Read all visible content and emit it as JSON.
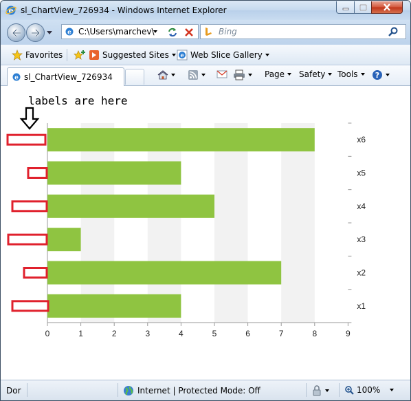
{
  "window": {
    "title": "sl_ChartView_726934 - Windows Internet Explorer"
  },
  "address": {
    "url": "C:\\Users\\marchev\\",
    "search_placeholder": "Bing"
  },
  "favorites": {
    "favorites_label": "Favorites",
    "suggested_label": "Suggested Sites",
    "webslice_label": "Web Slice Gallery"
  },
  "tab": {
    "label": "sl_ChartView_726934"
  },
  "commands": {
    "page": "Page",
    "safety": "Safety",
    "tools": "Tools"
  },
  "content": {
    "annotation": "labels are here"
  },
  "status": {
    "text": "Dor",
    "zone": "Internet | Protected Mode: Off",
    "zoom": "100%"
  },
  "colors": {
    "bar": "#8fc441",
    "stripe": "#f2f2f2",
    "highlight": "#e0212d"
  },
  "chart_data": {
    "type": "bar",
    "orientation": "horizontal",
    "categories": [
      "x1",
      "x2",
      "x3",
      "x4",
      "x5",
      "x6"
    ],
    "values": [
      4,
      7,
      1,
      5,
      4,
      8
    ],
    "xlim": [
      0,
      9
    ],
    "xticks": [
      0,
      1,
      2,
      3,
      4,
      5,
      6,
      7,
      8,
      9
    ],
    "category_axis_position": "right",
    "grid": "alternating vertical stripes"
  }
}
